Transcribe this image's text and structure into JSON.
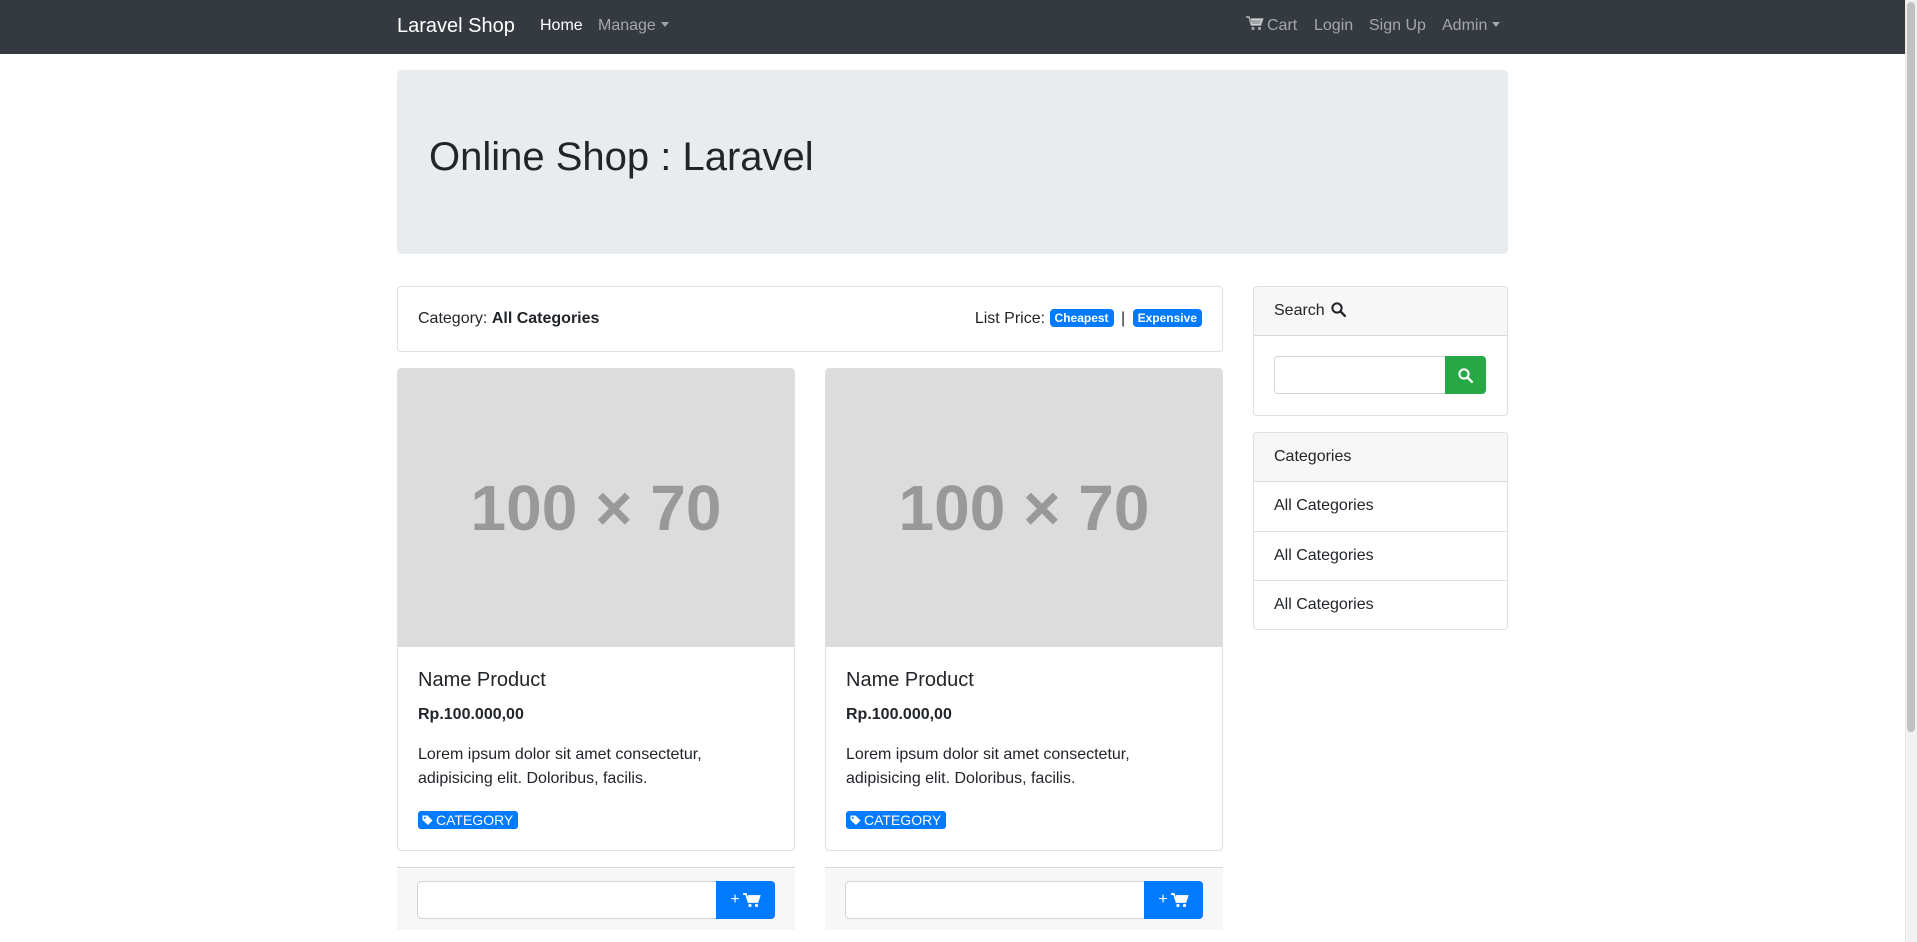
{
  "navbar": {
    "brand": "Laravel Shop",
    "home": "Home",
    "manage": "Manage",
    "cart": "Cart",
    "login": "Login",
    "signup": "Sign Up",
    "admin": "Admin",
    "background_color": "#343a40"
  },
  "jumbotron": {
    "title": "Online Shop : Laravel"
  },
  "filter": {
    "category_label": "Category:",
    "category_value": "All Categories",
    "price_label": "List Price:",
    "cheapest": "Cheapest",
    "separator": "|",
    "expensive": "Expensive"
  },
  "products": [
    {
      "image_placeholder": "100 × 70",
      "name": "Name Product",
      "price": "Rp.100.000,00",
      "description": "Lorem ipsum dolor sit amet consectetur, adipisicing elit. Doloribus, facilis.",
      "category": "CATEGORY",
      "add_label": "+",
      "quantity_value": ""
    },
    {
      "image_placeholder": "100 × 70",
      "name": "Name Product",
      "price": "Rp.100.000,00",
      "description": "Lorem ipsum dolor sit amet consectetur, adipisicing elit. Doloribus, facilis.",
      "category": "CATEGORY",
      "add_label": "+",
      "quantity_value": ""
    }
  ],
  "sidebar": {
    "search_title": "Search",
    "search_value": "",
    "categories_title": "Categories",
    "categories": [
      "All Categories",
      "All Categories",
      "All Categories"
    ]
  },
  "colors": {
    "primary": "#007bff",
    "success": "#28a745",
    "jumbotron_bg": "#e9ecef",
    "placeholder_bg": "#dcdcdc"
  },
  "icons": {
    "cart": "shopping-cart-icon",
    "search": "magnifier-icon",
    "tag": "tags-icon"
  }
}
